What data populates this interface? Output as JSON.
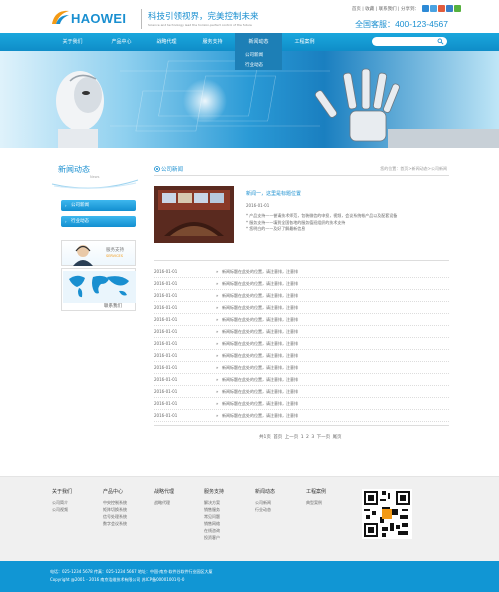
{
  "brand": {
    "logo_text": "HAOWEI",
    "slogan": "科技引领视界，完美控制未来",
    "slogan_sub": "Science and technology lead the horizon,perfect control of the future"
  },
  "top_links": "首页 | 收藏 | 联系我们 | 分享到：",
  "hotline": {
    "label": "全国客服：",
    "number": "400-123-4567"
  },
  "nav": {
    "items": [
      {
        "label": "关于我们"
      },
      {
        "label": "产品中心"
      },
      {
        "label": "战略代理"
      },
      {
        "label": "服务支持"
      },
      {
        "label": "新闻动态"
      },
      {
        "label": "工程案例"
      }
    ],
    "dropdown": [
      "公司新闻",
      "行业动态"
    ]
  },
  "sidebar": {
    "title": "新闻动态",
    "title_en": "News",
    "items": [
      {
        "label": "公司新闻"
      },
      {
        "label": "行业动态"
      }
    ],
    "service_title": "服务支持",
    "service_en": "SERVICES",
    "contact_label": "联系我们"
  },
  "main": {
    "title": "公司新闻",
    "breadcrumb": "您的位置：首页>新闻动态>公司新闻",
    "featured": {
      "title": "新闻一，这里是标题位置",
      "date": "2016-01-01",
      "lines": [
        "* 产品支持——誉请技术师范，包装微信的申投，视频，会议系统帐产品以及配套设备",
        "* 服务支持——填到全国各地的服务值班组织的技术支持",
        "* 您明白的——及好了解最新信息"
      ]
    },
    "news": [
      {
        "date": "2016-01-01",
        "title": "新闻标题在此处的位置，请注意排，注意排"
      },
      {
        "date": "2016-01-01",
        "title": "新闻标题在此处的位置，请注意排，注意排"
      },
      {
        "date": "2016-01-01",
        "title": "新闻标题在此处的位置，请注意排，注意排"
      },
      {
        "date": "2016-01-01",
        "title": "新闻标题在此处的位置，请注意排，注意排"
      },
      {
        "date": "2016-01-01",
        "title": "新闻标题在此处的位置，请注意排，注意排"
      },
      {
        "date": "2016-01-01",
        "title": "新闻标题在此处的位置，请注意排，注意排"
      },
      {
        "date": "2016-01-01",
        "title": "新闻标题在此处的位置，请注意排，注意排"
      },
      {
        "date": "2016-01-01",
        "title": "新闻标题在此处的位置，请注意排，注意排"
      },
      {
        "date": "2016-01-01",
        "title": "新闻标题在此处的位置，请注意排，注意排"
      },
      {
        "date": "2016-01-01",
        "title": "新闻标题在此处的位置，请注意排，注意排"
      },
      {
        "date": "2016-01-01",
        "title": "新闻标题在此处的位置，请注意排，注意排"
      },
      {
        "date": "2016-01-01",
        "title": "新闻标题在此处的位置，请注意排，注意排"
      },
      {
        "date": "2016-01-01",
        "title": "新闻标题在此处的位置，请注意排，注意排"
      }
    ],
    "pager": {
      "total": "共1页",
      "first": "首页",
      "prev": "上一页",
      "pages": [
        "1",
        "2",
        "3"
      ],
      "next": "下一页",
      "last": "尾页"
    }
  },
  "footer": {
    "columns": [
      {
        "head": "关于我们",
        "items": [
          "公司简介",
          "公司视频"
        ]
      },
      {
        "head": "产品中心",
        "items": [
          "中央控制系统",
          "矩阵切换系统",
          "信号处理系统",
          "数字会议系统"
        ]
      },
      {
        "head": "战略代理",
        "items": [
          "战略代理"
        ]
      },
      {
        "head": "服务支持",
        "items": [
          "解决方案",
          "销售服务",
          "常见问题",
          "销售网络",
          "在线咨询",
          "投资客户"
        ]
      },
      {
        "head": "新闻动态",
        "items": [
          "公司新闻",
          "行业动态"
        ]
      },
      {
        "head": "工程案例",
        "items": [
          "典型案例"
        ]
      }
    ],
    "contact_line": "电话：025-1234 5678   传真：025-1234 5667   地址：中国·南京·软件谷软件行业园区大厦",
    "copyright": "Copyright  @2001 - 2016  南京浩维技术有限公司  苏ICP备00001001号-0"
  },
  "colors": {
    "accent": "#1a8fd0",
    "nav_bg": "#1aa7dd",
    "bottom_bar": "#1196d4"
  }
}
